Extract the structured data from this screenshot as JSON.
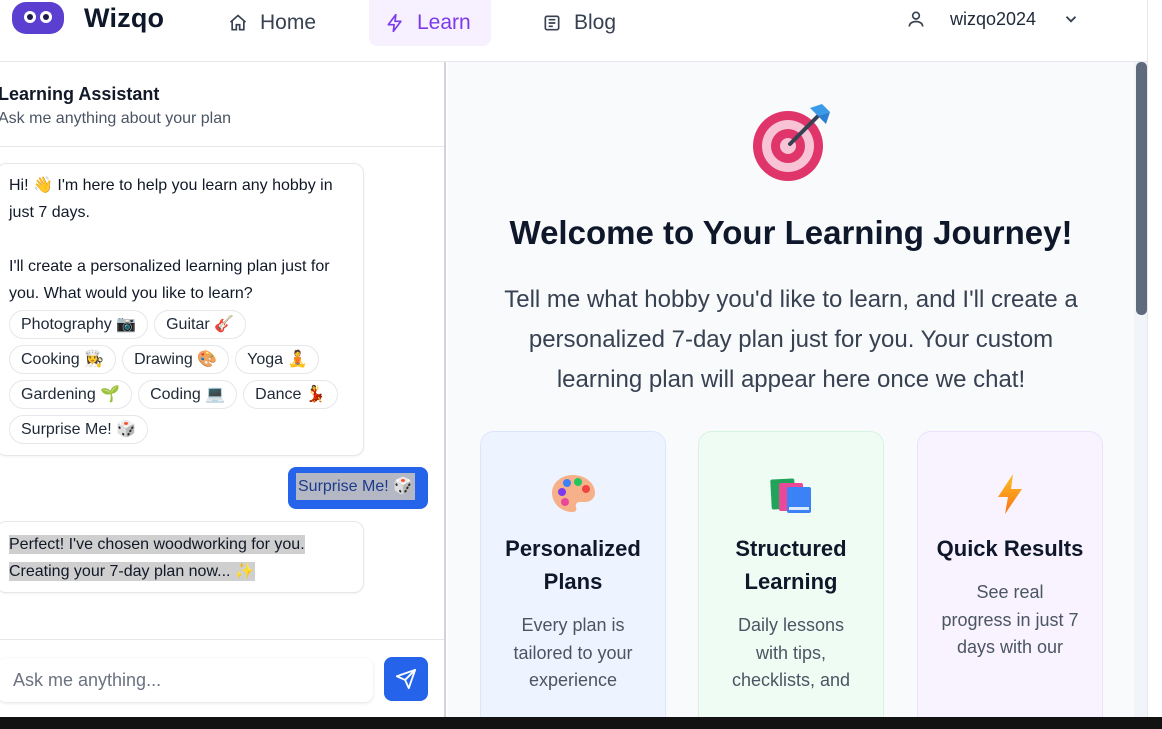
{
  "nav": {
    "brand": "Wizqo",
    "items": [
      {
        "label": "Home",
        "icon": "home-icon"
      },
      {
        "label": "Learn",
        "icon": "lightning-icon",
        "active": true
      },
      {
        "label": "Blog",
        "icon": "newspaper-icon"
      }
    ],
    "username": "wizqo2024"
  },
  "chat": {
    "title": "Learning Assistant",
    "subtitle": "Ask me anything about your plan",
    "bot_message_1": {
      "line1": "Hi! 👋 I'm here to help you learn any hobby in just 7 days.",
      "line2": "I'll create a personalized learning plan just for you. What would you like to learn?"
    },
    "chips": [
      "Photography 📷",
      "Guitar 🎸",
      "Cooking 👩‍🍳",
      "Drawing 🎨",
      "Yoga 🧘",
      "Gardening 🌱",
      "Coding 💻",
      "Dance 💃",
      "Surprise Me! 🎲"
    ],
    "user_message": "Surprise Me! 🎲",
    "bot_message_2": {
      "line1": "Perfect! I've chosen woodworking for you.",
      "line2": "Creating your 7-day plan now... ✨"
    },
    "input_placeholder": "Ask me anything..."
  },
  "main": {
    "title": "Welcome to Your Learning Journey!",
    "description": "Tell me what hobby you'd like to learn, and I'll create a personalized 7-day plan just for you. Your custom learning plan will appear here once we chat!",
    "cards": [
      {
        "icon": "palette-icon",
        "title": "Personalized Plans",
        "text": "Every plan is tailored to your experience"
      },
      {
        "icon": "books-icon",
        "title": "Structured Learning",
        "text": "Daily lessons with tips, checklists, and"
      },
      {
        "icon": "lightning-icon",
        "title": "Quick Results",
        "text": "See real progress in just 7 days with our"
      }
    ]
  },
  "colors": {
    "accent": "#7c3aed",
    "primary_button": "#2563eb",
    "logo": "#5b3fd1"
  }
}
